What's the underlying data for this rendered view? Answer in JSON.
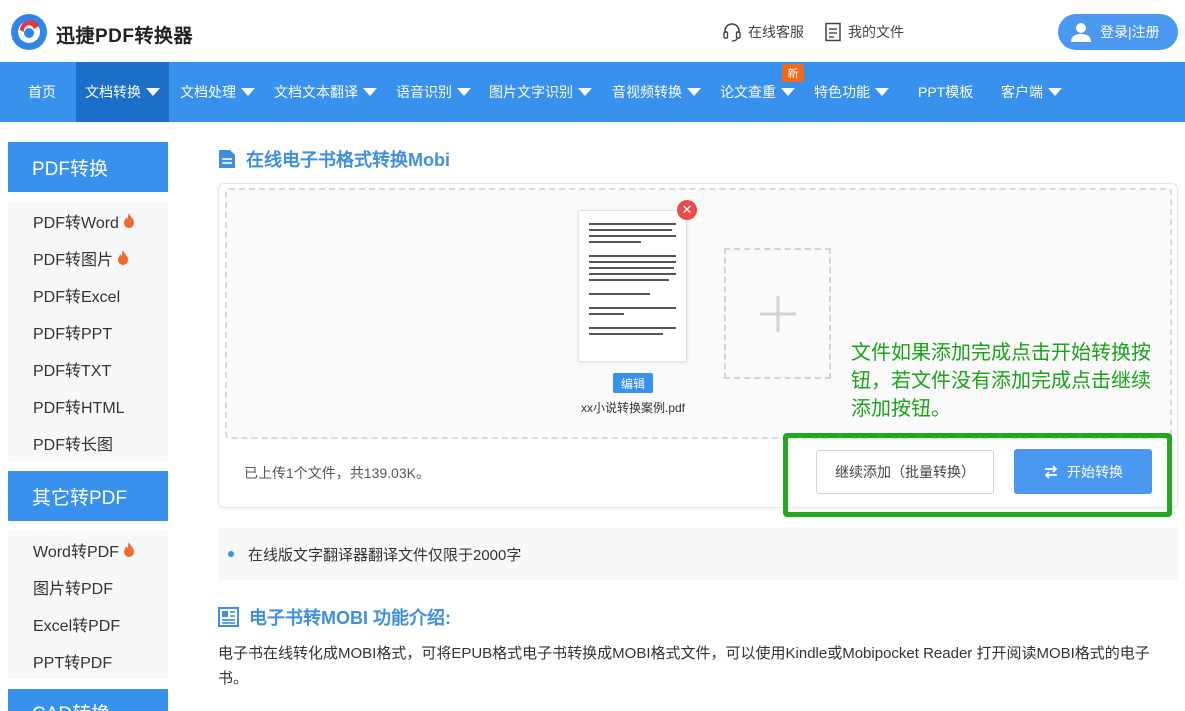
{
  "header": {
    "brand": "迅捷PDF转换器",
    "service_label": "在线客服",
    "files_label": "我的文件",
    "login_label": "登录|注册"
  },
  "nav": {
    "items": [
      {
        "label": "首页"
      },
      {
        "label": "文档转换"
      },
      {
        "label": "文档处理"
      },
      {
        "label": "文档文本翻译"
      },
      {
        "label": "语音识别"
      },
      {
        "label": "图片文字识别"
      },
      {
        "label": "音视频转换"
      },
      {
        "label": "论文查重"
      },
      {
        "label": "特色功能"
      },
      {
        "label": "PPT模板"
      },
      {
        "label": "客户端"
      }
    ],
    "new_badge": "新"
  },
  "sidebar": {
    "groups": [
      {
        "title": "PDF转换",
        "items": [
          {
            "label": "PDF转Word"
          },
          {
            "label": "PDF转图片"
          },
          {
            "label": "PDF转Excel"
          },
          {
            "label": "PDF转PPT"
          },
          {
            "label": "PDF转TXT"
          },
          {
            "label": "PDF转HTML"
          },
          {
            "label": "PDF转长图"
          }
        ]
      },
      {
        "title": "其它转PDF",
        "items": [
          {
            "label": "Word转PDF"
          },
          {
            "label": "图片转PDF"
          },
          {
            "label": "Excel转PDF"
          },
          {
            "label": "PPT转PDF"
          }
        ]
      },
      {
        "title": "CAD转换",
        "items": []
      }
    ]
  },
  "main": {
    "title": "在线电子书格式转换Mobi",
    "file": {
      "name": "xx小说转换案例.pdf",
      "edit_label": "编辑"
    },
    "annotation": "文件如果添加完成点击开始转换按钮，若文件没有添加完成点击继续添加按钮。",
    "upload_info": "已上传1个文件，共139.03K。",
    "continue_label": "继续添加（批量转换）",
    "start_label": "开始转换",
    "note": "在线版文字翻译器翻译文件仅限于2000字",
    "intro_title": "电子书转MOBI 功能介绍:",
    "intro_text": "电子书在线转化成MOBI格式，可将EPUB格式电子书转换成MOBI格式文件，可以使用Kindle或Mobipocket Reader 打开阅读MOBI格式的电子书。"
  },
  "colors": {
    "primary": "#3891ec",
    "primary_dark": "#1c6fc8",
    "annotation_green": "#21a821",
    "close_red": "#ea4b4b",
    "badge_orange": "#f56a18",
    "flame_orange": "#f26b2c"
  },
  "icons": {
    "logo": "logo-icon",
    "service": "headset-icon",
    "files": "file-list-icon",
    "user": "user-icon",
    "document": "document-icon",
    "intro": "newspaper-icon",
    "flame": "flame-icon",
    "add": "plus-icon",
    "close": "close-icon",
    "convert": "swap-icon"
  }
}
